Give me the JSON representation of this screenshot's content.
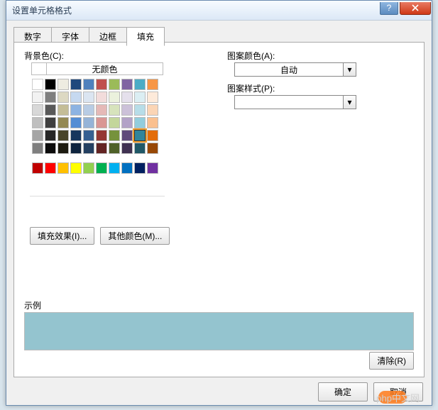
{
  "window": {
    "title": "设置单元格格式"
  },
  "tabs": {
    "items": [
      "数字",
      "字体",
      "边框",
      "填充"
    ],
    "activeIndex": 3
  },
  "fill": {
    "bgColorLabel": "背景色(C):",
    "noColorLabel": "无颜色",
    "fillEffectsBtn": "填充效果(I)...",
    "moreColorsBtn": "其他颜色(M)...",
    "patternColorLabel": "图案颜色(A):",
    "patternColorValue": "自动",
    "patternStyleLabel": "图案样式(P):",
    "sampleLabel": "示例",
    "clearBtn": "清除(R)",
    "sampleColor": "#94c4cf",
    "selectedSwatch": {
      "row": 4,
      "col": 8
    },
    "themeColors": [
      [
        "#ffffff",
        "#000000",
        "#eeece1",
        "#1f497d",
        "#4f81bd",
        "#c0504d",
        "#9bbb59",
        "#8064a2",
        "#4bacc6",
        "#f79646"
      ],
      [
        "#f2f2f2",
        "#7f7f7f",
        "#ddd9c3",
        "#c6d9f0",
        "#dbe5f1",
        "#f2dcdb",
        "#ebf1dd",
        "#e5e0ec",
        "#dbeef3",
        "#fdeada"
      ],
      [
        "#d8d8d8",
        "#595959",
        "#c4bd97",
        "#8db3e2",
        "#b8cce4",
        "#e5b9b7",
        "#d7e3bc",
        "#ccc1d9",
        "#b7dde8",
        "#fbd5b5"
      ],
      [
        "#bfbfbf",
        "#3f3f3f",
        "#938953",
        "#548dd4",
        "#95b3d7",
        "#d99694",
        "#c3d69b",
        "#b2a2c7",
        "#92cddc",
        "#fac08f"
      ],
      [
        "#a5a5a5",
        "#262626",
        "#494429",
        "#17365d",
        "#366092",
        "#953734",
        "#76923c",
        "#5f497a",
        "#31859b",
        "#e36c09"
      ],
      [
        "#7f7f7f",
        "#0c0c0c",
        "#1d1b10",
        "#0f243e",
        "#244061",
        "#632423",
        "#4f6128",
        "#3f3151",
        "#205867",
        "#974806"
      ]
    ],
    "standardColors": [
      "#c00000",
      "#ff0000",
      "#ffc000",
      "#ffff00",
      "#92d050",
      "#00b050",
      "#00b0f0",
      "#0070c0",
      "#002060",
      "#7030a0"
    ]
  },
  "footer": {
    "ok": "确定",
    "cancel": "取消"
  },
  "watermark": "php中文网"
}
